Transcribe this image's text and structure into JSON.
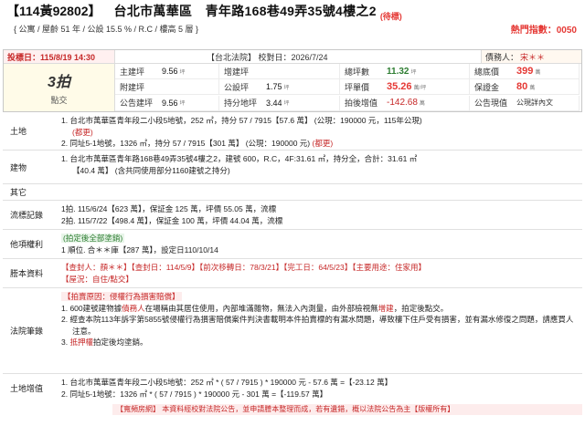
{
  "header": {
    "case_no": "【114黃92802】",
    "address": "台北市萬華區　青年路168巷49弄35號4樓之2",
    "status": "(待標)",
    "sub_info": "{ 公寓 / 屋齡 51 年 / 公設 15.5 % / R.C / 樓高 5 層 }",
    "hot_index": "熱門指數：0050"
  },
  "summary": {
    "bid_date_label": "投標日：115/8/19 14:30",
    "court_info": "【台北法院】 校對日：2026/7/24",
    "creditor_label": "債務人：",
    "creditor_value": "宋＊＊",
    "round": "3拍",
    "round_type": "點交",
    "cells": [
      {
        "label": "主建坪",
        "value": "9.56",
        "unit": "坪",
        "style": "v"
      },
      {
        "label": "增建坪",
        "value": "",
        "unit": "",
        "style": "v"
      },
      {
        "label": "總坪數",
        "value": "11.32",
        "unit": "坪",
        "style": "vg"
      },
      {
        "label": "總底價",
        "value": "399",
        "unit": "萬",
        "style": "vr"
      },
      {
        "label": "附建坪",
        "value": "",
        "unit": "",
        "style": "v"
      },
      {
        "label": "公設坪",
        "value": "1.75",
        "unit": "坪",
        "style": "v"
      },
      {
        "label": "坪單價",
        "value": "35.26",
        "unit": "萬/坪",
        "style": "vr"
      },
      {
        "label": "保證金",
        "value": "80",
        "unit": "萬",
        "style": "vr"
      },
      {
        "label": "公告建坪",
        "value": "9.56",
        "unit": "坪",
        "style": "v"
      },
      {
        "label": "持分地坪",
        "value": "3.44",
        "unit": "坪",
        "style": "v"
      },
      {
        "label": "拍後增值",
        "value": "-142.68",
        "unit": "萬",
        "style": "vr2"
      },
      {
        "label": "公告現值",
        "value": "公現詳內文",
        "unit": "",
        "style": "plain"
      }
    ]
  },
  "sections": {
    "land": {
      "label": "土地",
      "line1": "1. 台北市萬華區青年段二小段5地號，252 ㎡，持分 57 / 7915【57.6 萬】 (公現：190000 元，115年公現)",
      "line1_note": "(都更)",
      "line2": "2. 同址5-1地號，1326 ㎡，持分 57 / 7915【301 萬】 (公現：190000 元)",
      "line2_note": "(都更)"
    },
    "building": {
      "label": "建物",
      "line1": "1. 台北市萬華區青年路168巷49弄35號4樓之2，建號 600，R.C，4F:31.61 ㎡，持分全，合計：31.61 ㎡",
      "line2": "【40.4 萬】 (含共同使用部分1160建號之持分)"
    },
    "other": {
      "label": "其它"
    },
    "auction_history": {
      "label": "流標記錄",
      "line1": "1拍. 115/6/24【623 萬】，保証金 125 萬，坪價 55.05 萬，流標",
      "line2": "2拍. 115/7/22【498.4 萬】，保証金 100 萬，坪價 44.04 萬，流標"
    },
    "other_rights": {
      "label": "他項權利",
      "line1": "(拍定後全部塗銷)",
      "line2": "1 順位. 合＊＊庫【287 萬】，設定日110/10/14"
    },
    "registry": {
      "label": "謄本資料",
      "line1": "【查封人：顏＊＊】【查封日：114/5/9】【前次移轉日：78/3/21】【完工日：64/5/23】【主要用途：住家用】",
      "line2": "【屋況：自住/點交】"
    },
    "court_notes": {
      "label": "法院筆錄",
      "header": "【拍賣原因：侵權行為損害賠償】",
      "line1a": "1. 600建號建物據",
      "line1b": "債務人",
      "line1c": "在場稱由其居住使用，內部堆滿雜物，無法入內測量，由外部檢視無",
      "line1d": "增建",
      "line1e": "，拍定後點交。",
      "line2": "2. 經查本院113年訴字第5855號侵權行為損害賠償案件判決書載明本件拍賣標的有漏水問題，導致樓下住戶受有損害，並有漏水修復之問題，請應買人注意。",
      "line3a": "3. ",
      "line3b": "抵押權",
      "line3c": "拍定後均塗銷。"
    },
    "land_value": {
      "label": "土地增值",
      "line1": "1. 台北市萬華區青年段二小段5地號：252 ㎡ * ( 57 / 7915 ) * 190000 元 - 57.6 萬 =【-23.12 萬】",
      "line2": "2. 同址5-1地號：1326 ㎡ * ( 57 / 7915 ) * 190000 元 - 301 萬 =【-119.57 萬】"
    }
  },
  "notice": "【寬頻房網】 本資料經校對法院公告，並申請謄本整理而成，若有遺錯，概以法院公告為主【版權所有】"
}
